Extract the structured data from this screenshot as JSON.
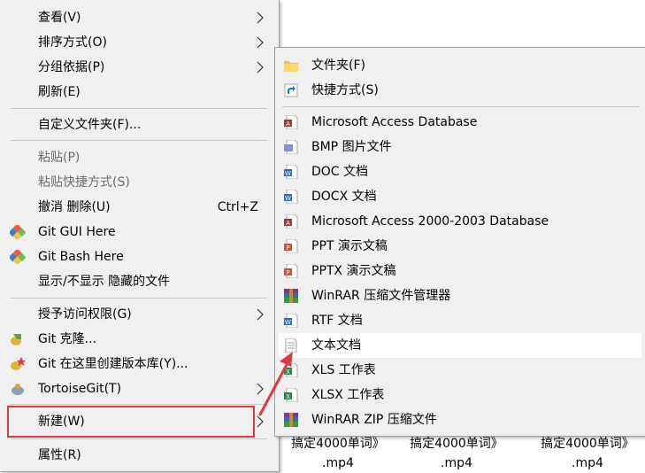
{
  "main_menu": {
    "view": "查看(V)",
    "sort": "排序方式(O)",
    "group": "分组依据(P)",
    "refresh": "刷新(E)",
    "customize": "自定义文件夹(F)...",
    "paste": "粘贴(P)",
    "paste_shortcut": "粘贴快捷方式(S)",
    "undo": "撤消 删除(U)",
    "undo_shortcut": "Ctrl+Z",
    "git_gui": "Git GUI Here",
    "git_bash": "Git Bash Here",
    "show_hidden": "显示/不显示 隐藏的文件",
    "grant_access": "授予访问权限(G)",
    "git_clone": "Git 克隆...",
    "git_create_repo": "Git 在这里创建版本库(Y)...",
    "tortoisegit": "TortoiseGit(T)",
    "new": "新建(W)",
    "properties": "属性(R)"
  },
  "sub_menu": {
    "folder": "文件夹(F)",
    "shortcut": "快捷方式(S)",
    "access_db": "Microsoft Access Database",
    "bmp": "BMP 图片文件",
    "doc": "DOC 文档",
    "docx": "DOCX 文档",
    "access_2000": "Microsoft Access 2000-2003 Database",
    "ppt": "PPT 演示文稿",
    "pptx": "PPTX 演示文稿",
    "winrar": "WinRAR 压缩文件管理器",
    "rtf": "RTF 文档",
    "txt": "文本文档",
    "xls": "XLS 工作表",
    "xlsx": "XLSX 工作表",
    "winrar_zip": "WinRAR ZIP 压缩文件"
  },
  "background_files": [
    {
      "line1": "搞定4000单词》",
      "line2": ".mp4"
    },
    {
      "line1": "搞定4000单词》",
      "line2": ".mp4"
    },
    {
      "line1": "搞定4000单词》",
      "line2": ".mp4"
    }
  ],
  "colors": {
    "highlight_box": "#e0393e",
    "menu_bg": "#f0f0f0"
  }
}
